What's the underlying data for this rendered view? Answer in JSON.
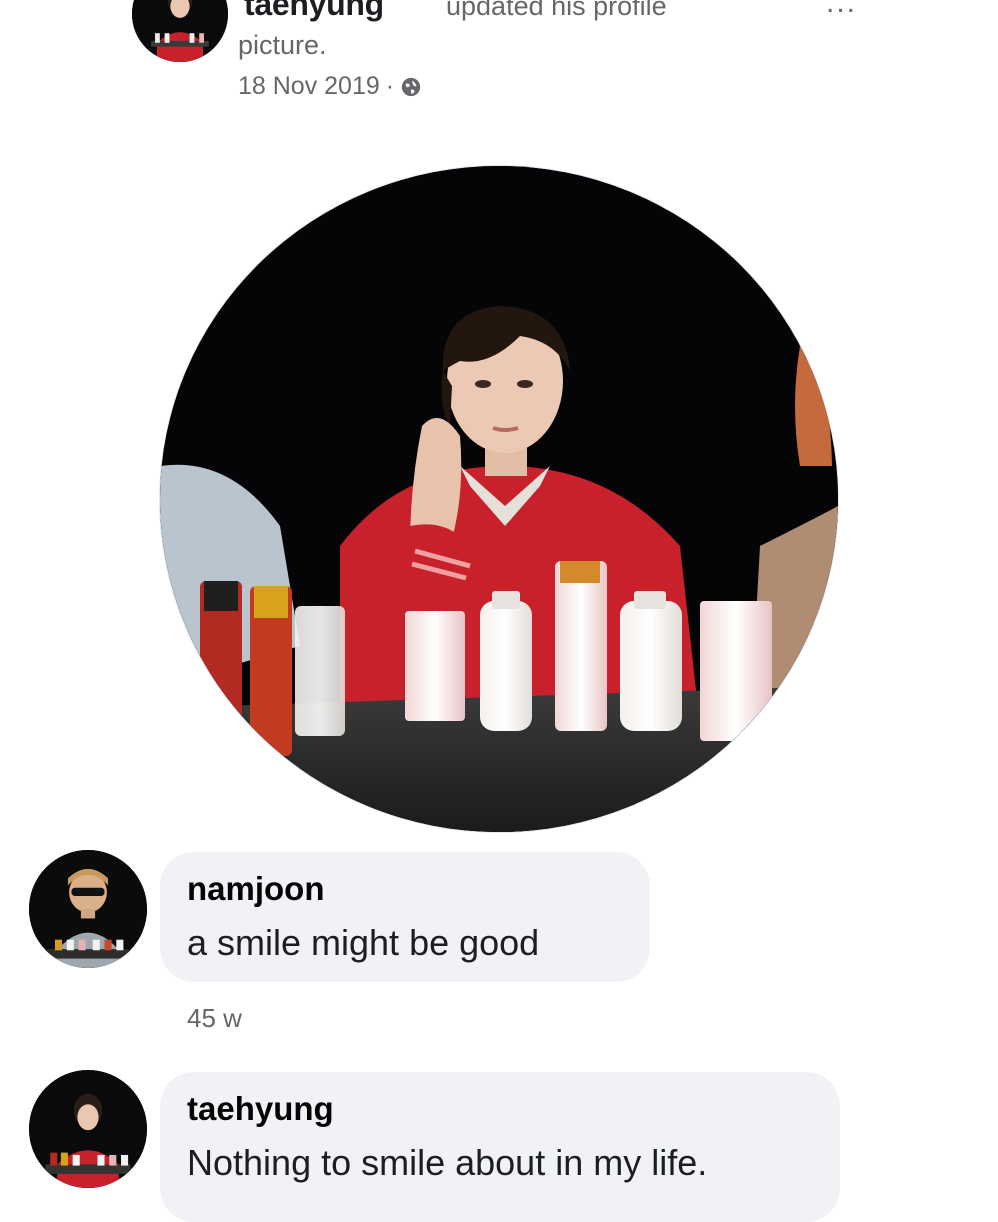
{
  "post": {
    "author": "taehyung",
    "action": "updated his profile",
    "action_cont": "picture.",
    "date": "18 Nov 2019",
    "separator": "·",
    "privacy_icon": "globe-icon",
    "more_icon": "more-options-icon",
    "more_label": "..."
  },
  "comments": [
    {
      "author": "namjoon",
      "text": "a smile might be good",
      "time": "45 w"
    },
    {
      "author": "taehyung",
      "text": "Nothing to smile about in my life."
    }
  ],
  "colors": {
    "bubble": "#f0f2f5",
    "meta_text": "#65676b",
    "shirt_red": "#c8212c"
  }
}
